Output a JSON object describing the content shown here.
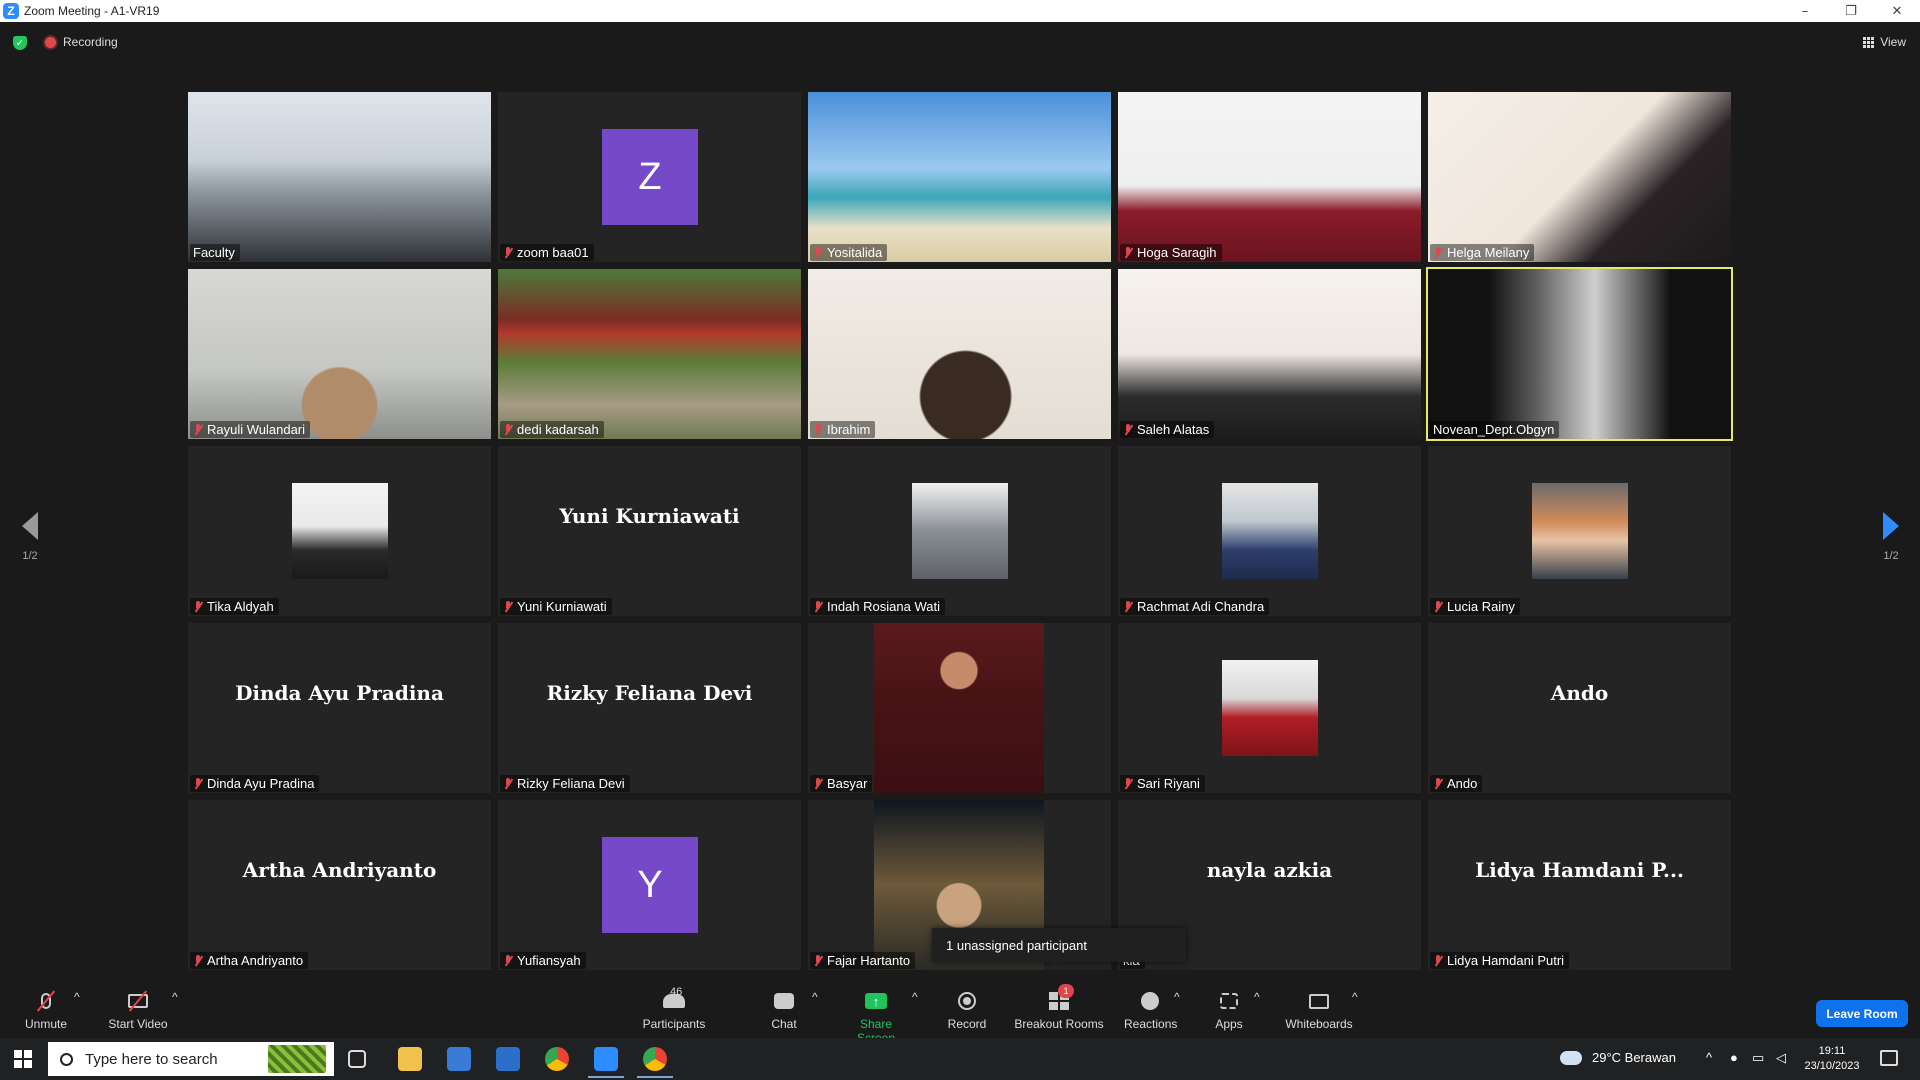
{
  "window": {
    "app_letter": "Z",
    "title": "Zoom Meeting - A1-VR19",
    "controls": [
      "–",
      "❐",
      "✕"
    ]
  },
  "topbar": {
    "recording_label": "Recording",
    "view_label": "View"
  },
  "pager": {
    "left": "1/2",
    "right": "1/2"
  },
  "colors": {
    "accent": "#2d8cff",
    "muted": "#e0474c",
    "share_green": "#21c35e",
    "leave_blue": "#0e72ed",
    "active_speaker": "#e6e86a",
    "avatar_purple": "#7649c9"
  },
  "tiles": [
    {
      "name": "Faculty",
      "kind": "video",
      "muted": false
    },
    {
      "name": "zoom baa01",
      "kind": "letter",
      "letter": "Z",
      "muted": true
    },
    {
      "name": "Yositalida",
      "kind": "video",
      "muted": true
    },
    {
      "name": "Hoga Saragih",
      "kind": "video",
      "muted": true
    },
    {
      "name": "Helga Meilany",
      "kind": "video",
      "muted": true
    },
    {
      "name": "Rayuli Wulandari",
      "kind": "video",
      "muted": true
    },
    {
      "name": "dedi kadarsah",
      "kind": "video",
      "muted": true
    },
    {
      "name": "Ibrahim",
      "kind": "video",
      "muted": true
    },
    {
      "name": "Saleh Alatas",
      "kind": "video",
      "muted": true
    },
    {
      "name": "Novean_Dept.Obgyn",
      "kind": "video",
      "muted": false,
      "active": true
    },
    {
      "name": "Tika Aldyah",
      "kind": "photo",
      "muted": true
    },
    {
      "name": "Yuni Kurniawati",
      "kind": "text",
      "display": "Yuni Kurniawati",
      "muted": true
    },
    {
      "name": "Indah Rosiana Wati",
      "kind": "photo",
      "muted": true
    },
    {
      "name": "Rachmat Adi Chandra",
      "kind": "photo",
      "muted": true
    },
    {
      "name": "Lucia Rainy",
      "kind": "photo",
      "muted": true
    },
    {
      "name": "Dinda Ayu Pradina",
      "kind": "text",
      "display": "Dinda Ayu Pradina",
      "muted": true
    },
    {
      "name": "Rizky Feliana Devi",
      "kind": "text",
      "display": "Rizky Feliana Devi",
      "muted": true
    },
    {
      "name": "Basyar",
      "kind": "tallphoto",
      "muted": true
    },
    {
      "name": "Sari Riyani",
      "kind": "photo",
      "muted": true
    },
    {
      "name": "Ando",
      "kind": "text",
      "display": "Ando",
      "muted": true
    },
    {
      "name": "Artha Andriyanto",
      "kind": "text",
      "display": "Artha Andriyanto",
      "muted": true
    },
    {
      "name": "Yufiansyah",
      "kind": "letter",
      "letter": "Y",
      "muted": true
    },
    {
      "name": "Fajar Hartanto",
      "kind": "tallphoto",
      "muted": true
    },
    {
      "name": "kia",
      "kind": "text",
      "display": "nayla azkia",
      "muted": false
    },
    {
      "name": "Lidya Hamdani Putri",
      "kind": "text",
      "display": "Lidya Hamdani P...",
      "muted": true
    }
  ],
  "tooltip": "1 unassigned participant",
  "toolbar": {
    "unmute": "Unmute",
    "start_video": "Start Video",
    "participants": "Participants",
    "participants_count": "46",
    "chat": "Chat",
    "share_screen": "Share Screen",
    "record": "Record",
    "breakout_rooms": "Breakout Rooms",
    "breakout_badge": "1",
    "reactions": "Reactions",
    "apps": "Apps",
    "whiteboards": "Whiteboards",
    "leave": "Leave Room"
  },
  "taskbar": {
    "search_placeholder": "Type here to search",
    "weather": "29°C  Berawan",
    "time": "19:11",
    "date": "23/10/2023"
  }
}
